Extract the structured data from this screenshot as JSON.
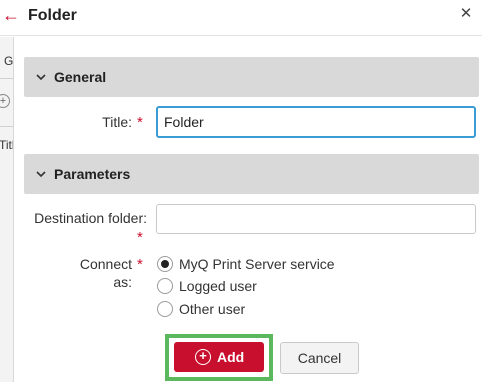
{
  "dialog": {
    "title": "Folder",
    "back_icon": "arrow-left-icon",
    "close_icon": "close-icon",
    "accent_color": "#c8102e"
  },
  "background_page": {
    "tab_label": "G",
    "column_label": "Titl"
  },
  "sections": {
    "general": {
      "label": "General",
      "icon": "chevron-down-icon"
    },
    "parameters": {
      "label": "Parameters",
      "icon": "chevron-down-icon"
    }
  },
  "fields": {
    "title": {
      "label": "Title:",
      "value": "Folder",
      "required": "*"
    },
    "destination": {
      "label_line1": "Destination folder:",
      "value": "",
      "required": "*"
    },
    "connect_as": {
      "label": "Connect as:",
      "required": "*",
      "options": [
        "MyQ Print Server service",
        "Logged user",
        "Other user"
      ],
      "selected": "MyQ Print Server service"
    }
  },
  "buttons": {
    "add_label": "Add",
    "cancel_label": "Cancel",
    "highlight_color": "#5cb85c"
  }
}
